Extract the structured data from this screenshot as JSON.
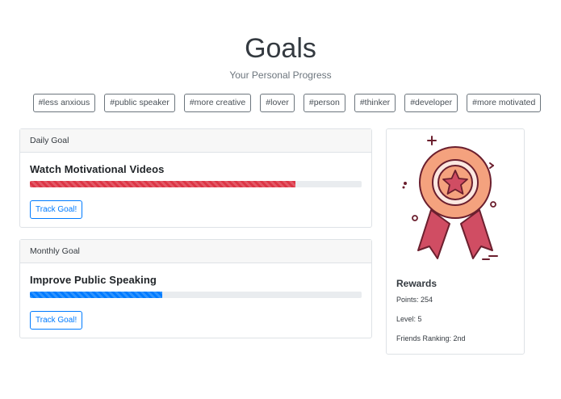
{
  "header": {
    "title": "Goals",
    "subtitle": "Your Personal Progress"
  },
  "tags": [
    "#less anxious",
    "#public speaker",
    "#more creative",
    "#lover",
    "#person",
    "#thinker",
    "#developer",
    "#more motivated"
  ],
  "goals": [
    {
      "type_label": "Daily Goal",
      "title": "Watch Motivational Videos",
      "progress_fraction": 0.8,
      "bar_color": "#dc3545",
      "button_label": "Track Goal!"
    },
    {
      "type_label": "Monthly Goal",
      "title": "Improve Public Speaking",
      "progress_fraction": 0.4,
      "bar_color": "#007bff",
      "button_label": "Track Goal!"
    }
  ],
  "rewards": {
    "title": "Rewards",
    "points": "Points: 254",
    "level": "Level: 5",
    "ranking": "Friends Ranking: 2nd",
    "icon": "medal-icon"
  },
  "colors": {
    "button_outline": "#007bff",
    "medal_orange": "#f4a27e",
    "medal_red": "#d04d63",
    "outline": "#6b1f2e"
  }
}
